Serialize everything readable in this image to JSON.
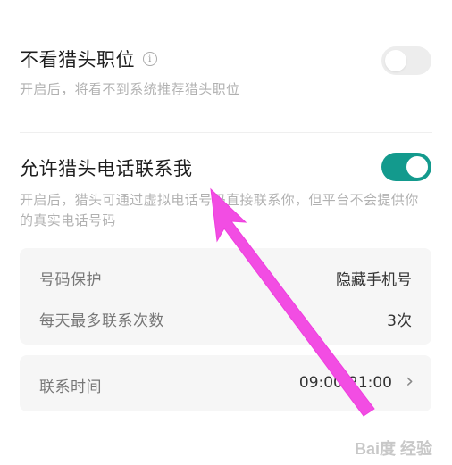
{
  "hide_position": {
    "title": "不看猎头职位",
    "description": "开启后，将看不到系统推荐猎头职位",
    "toggle_on": false
  },
  "allow_call": {
    "title": "允许猎头电话联系我",
    "description": "开启后，猎头可通过虚拟电话号码直接联系你，但平台不会提供你的真实电话号码",
    "toggle_on": true
  },
  "settings": {
    "number_protection_label": "号码保护",
    "number_protection_value": "隐藏手机号",
    "max_contacts_label": "每天最多联系次数",
    "max_contacts_value": "3次",
    "contact_time_label": "联系时间",
    "contact_time_value": "09:00-21:00"
  },
  "watermark": "Bai度 经验",
  "colors": {
    "accent": "#139a8d",
    "annotation_arrow": "#f24de3"
  }
}
